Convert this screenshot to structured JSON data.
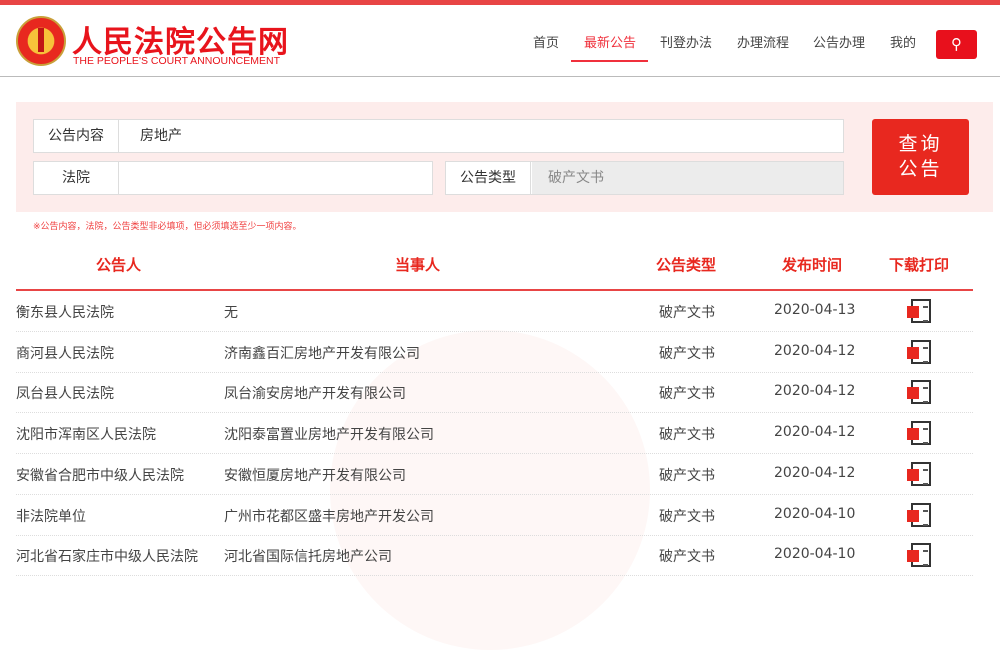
{
  "header": {
    "brand": "人民法院公告网",
    "brand_en": "THE PEOPLE'S COURT ANNOUNCEMENT",
    "nav": [
      "首页",
      "最新公告",
      "刊登办法",
      "办理流程",
      "公告办理",
      "我的"
    ]
  },
  "search": {
    "content_label": "公告内容",
    "content_value": "房地产",
    "court_label": "法院",
    "court_value": "",
    "type_label": "公告类型",
    "type_value": "破产文书",
    "button_line1": "查询",
    "button_line2": "公告",
    "note": "※公告内容，法院，公告类型非必填项，但必须填选至少一项内容。"
  },
  "table": {
    "headers": [
      "公告人",
      "当事人",
      "公告类型",
      "发布时间",
      "下载打印"
    ],
    "rows": [
      {
        "court": "衡东县人民法院",
        "party": "无",
        "type": "破产文书",
        "date": "2020-04-13"
      },
      {
        "court": "商河县人民法院",
        "party": "济南鑫百汇房地产开发有限公司",
        "type": "破产文书",
        "date": "2020-04-12"
      },
      {
        "court": "凤台县人民法院",
        "party": "凤台渝安房地产开发有限公司",
        "type": "破产文书",
        "date": "2020-04-12"
      },
      {
        "court": "沈阳市浑南区人民法院",
        "party": "沈阳泰富置业房地产开发有限公司",
        "type": "破产文书",
        "date": "2020-04-12"
      },
      {
        "court": "安徽省合肥市中级人民法院",
        "party": "安徽恒厦房地产开发有限公司",
        "type": "破产文书",
        "date": "2020-04-12"
      },
      {
        "court": "非法院单位",
        "party": "广州市花都区盛丰房地产开发公司",
        "type": "破产文书",
        "date": "2020-04-10"
      },
      {
        "court": "河北省石家庄市中级人民法院",
        "party": "河北省国际信托房地产公司",
        "type": "破产文书",
        "date": "2020-04-10"
      }
    ]
  }
}
